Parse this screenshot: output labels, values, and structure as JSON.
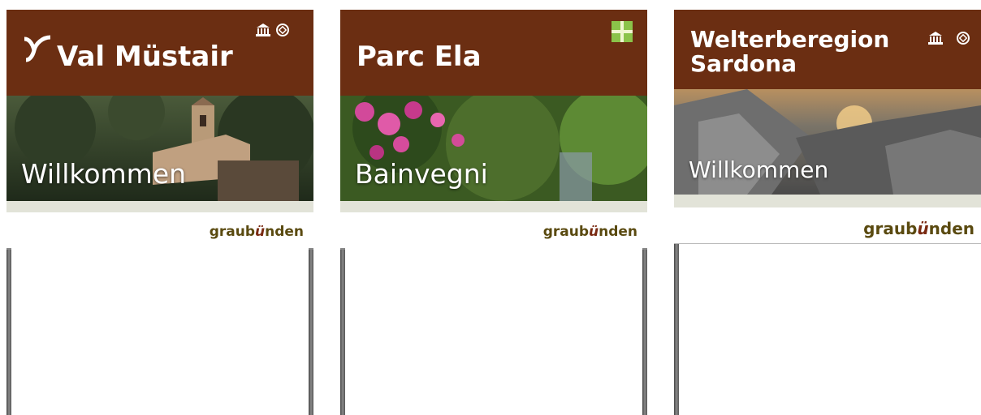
{
  "signs": [
    {
      "title": "Val Müstair",
      "logo_icon": "valley-logo-icon",
      "badges": [
        "unesco-icon",
        "world-heritage-icon"
      ],
      "welcome": "Willkommen",
      "brand": {
        "prefix": "graub",
        "mark": "ü",
        "suffix": "nden"
      }
    },
    {
      "title": "Parc Ela",
      "badges": [
        "park-label-icon"
      ],
      "welcome": "Bainvegni",
      "brand": {
        "prefix": "graub",
        "mark": "ü",
        "suffix": "nden"
      }
    },
    {
      "title": "Welterberegion Sardona",
      "badges": [
        "unesco-icon",
        "world-heritage-icon"
      ],
      "welcome": "Willkommen",
      "brand": {
        "prefix": "graub",
        "mark": "ü",
        "suffix": "nden"
      }
    }
  ],
  "colors": {
    "header": "#6b2e12",
    "band": "#e2e3d8",
    "brand_text": "#5a4a10",
    "post": "#8a8a8a"
  }
}
